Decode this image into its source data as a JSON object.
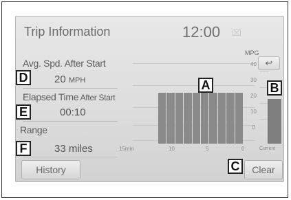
{
  "header": {
    "title": "Trip Information",
    "clock": "12:00"
  },
  "stats": {
    "avg_speed_label": "Avg. Spd. After Start",
    "avg_speed_value": "20",
    "avg_speed_unit": "MPH",
    "elapsed_label_main": "Elapsed Time",
    "elapsed_label_small": " After Start",
    "elapsed_value": "00:10",
    "range_label": "Range",
    "range_value": "33 miles"
  },
  "chart": {
    "unit_label": "MPG",
    "y_ticks": [
      "40",
      "30",
      "20",
      "10",
      "0"
    ],
    "x_ticks": [
      "15min",
      "10",
      "5",
      "0"
    ],
    "current_label": "Current",
    "history_bar_color": "#8a8a8a",
    "current_bar_color": "#7e7e7e"
  },
  "chart_data": {
    "type": "bar",
    "title": "",
    "ylabel": "MPG",
    "ylim": [
      0,
      40
    ],
    "x_tick_labels": [
      "15min",
      "10",
      "5",
      "0"
    ],
    "history_values": [
      25,
      25,
      25,
      25,
      25,
      25,
      25,
      25,
      25,
      25
    ],
    "current_value": 22
  },
  "buttons": {
    "history": "History",
    "clear": "Clear",
    "back_icon": "back-arrow-icon"
  },
  "callouts": {
    "a": "A",
    "b": "B",
    "c": "C",
    "d": "D",
    "e": "E",
    "f": "F"
  }
}
